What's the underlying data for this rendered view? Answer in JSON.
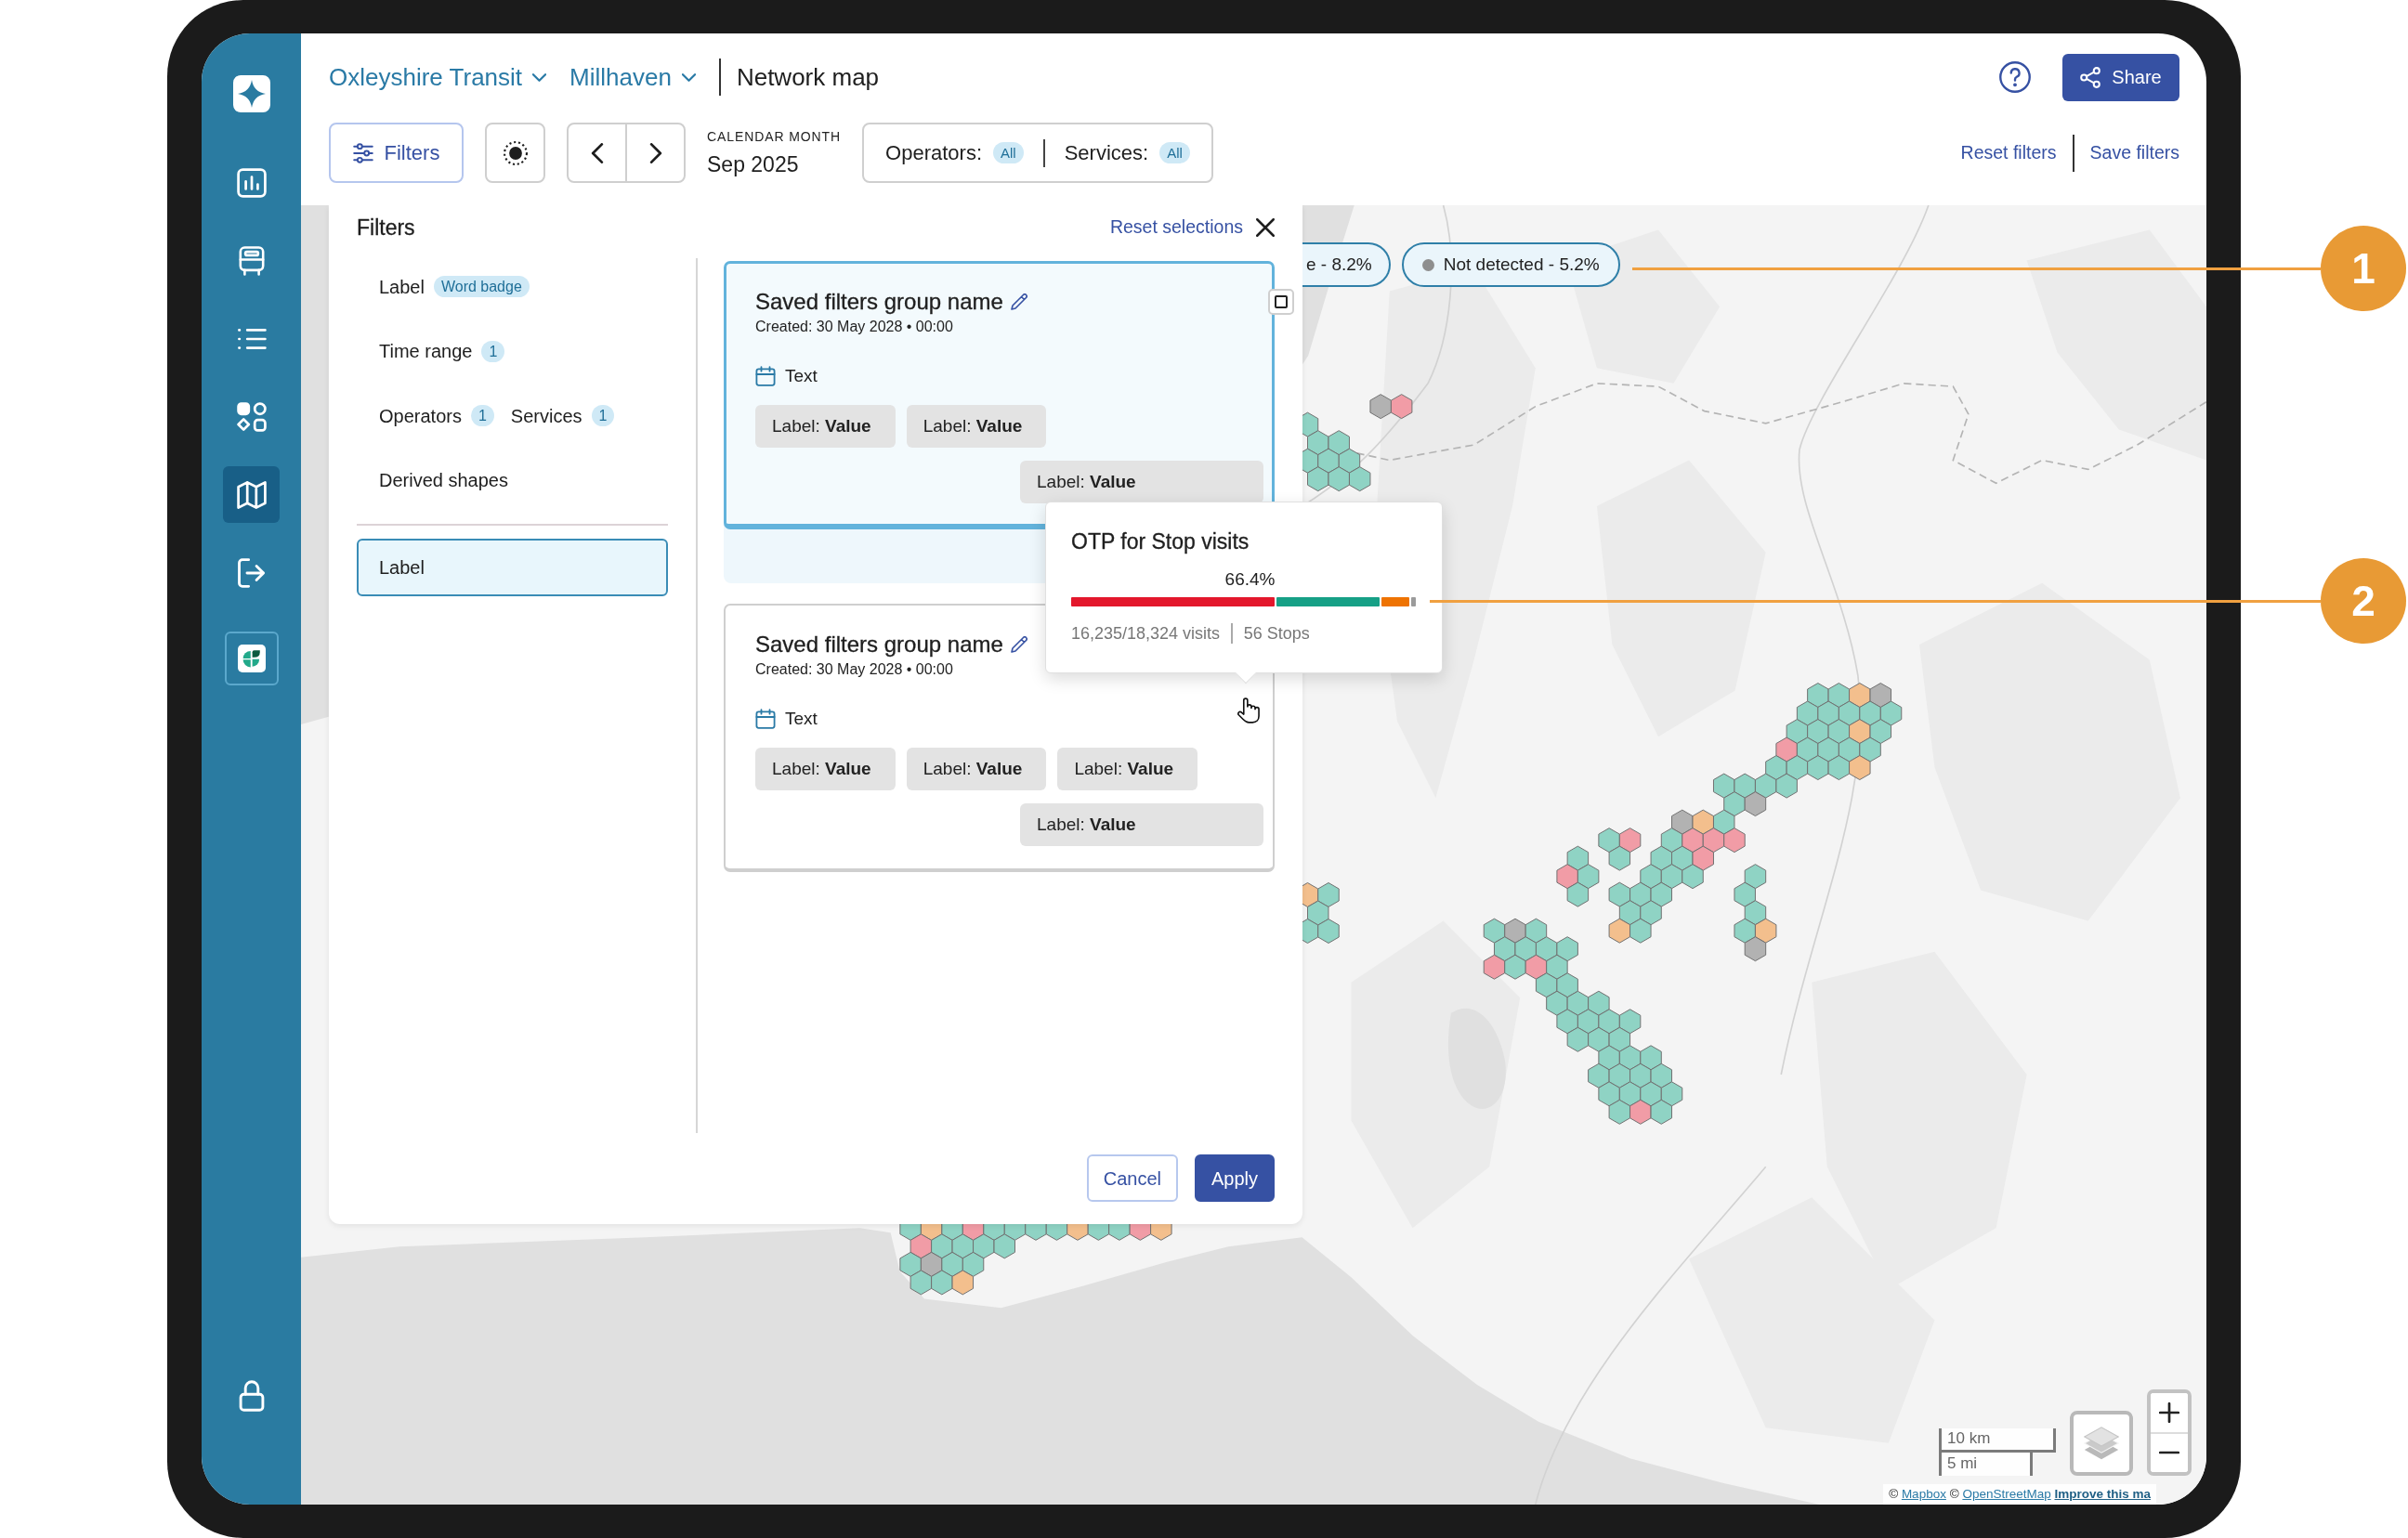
{
  "sidebar": {
    "items": [
      {
        "kind": "chart",
        "selected": false
      },
      {
        "kind": "bus",
        "selected": false
      },
      {
        "kind": "list",
        "selected": false
      },
      {
        "kind": "apps",
        "selected": false
      },
      {
        "kind": "map",
        "selected": true
      },
      {
        "kind": "exit",
        "selected": false
      },
      {
        "kind": "app",
        "selected": false
      }
    ]
  },
  "header": {
    "breadcrumbs": [
      "Oxleyshire Transit",
      "Millhaven"
    ],
    "title": "Network map",
    "share": "Share"
  },
  "toolbar": {
    "filters": {
      "label": "Filters",
      "selected": true
    },
    "period": {
      "label": "CALENDAR MONTH",
      "value": "Sep 2025"
    },
    "scope": [
      {
        "label": "Operators:",
        "badge": "All"
      },
      {
        "label": "Services:",
        "badge": "All"
      }
    ],
    "links": [
      "Reset filters",
      "Save filters"
    ]
  },
  "filter_panel": {
    "title": "Filters",
    "reset": "Reset selections",
    "categories": [
      [
        {
          "label": "Label",
          "badge": "Word badge"
        }
      ],
      [
        {
          "label": "Time range",
          "badge": "1"
        }
      ],
      [
        {
          "label": "Operators",
          "badge": "1"
        },
        {
          "label": "Services",
          "badge": "1"
        }
      ],
      [
        {
          "label": "Derived shapes"
        }
      ]
    ],
    "groups": [
      {
        "label": "Label",
        "selected": true
      }
    ],
    "cards": [
      {
        "title": "Saved filters group name",
        "created": "Created: 30 May 2028 • 00:00",
        "selected": true,
        "checked": false,
        "date": "Text",
        "chip_rows": [
          [
            "Label: **Value**",
            "Label: **Value**"
          ],
          [
            "Label: **Value**"
          ]
        ]
      },
      {
        "title": "Saved filters group name",
        "created": "Created: 30 May 2028 • 00:00",
        "selected": false,
        "date": "Text",
        "chip_rows": [
          [
            "Label: **Value**",
            "Label: **Value**",
            "Label: **Value**"
          ],
          [
            "Label: **Value**"
          ]
        ]
      }
    ],
    "actions": [
      {
        "label": "Cancel",
        "kind": "secondary"
      },
      {
        "label": "Apply",
        "kind": "primary"
      }
    ]
  },
  "map": {
    "legend": [
      {
        "label": "e - 8.2%"
      },
      {
        "label": "Not detected - 5.2%",
        "color": "#8e8e8e"
      }
    ],
    "tooltip": {
      "title": "OTP for Stop visits",
      "percent": "66.4%",
      "visits": "16,235/18,324 visits",
      "stops": "56 Stops"
    },
    "scale": [
      "10 km",
      "5 mi"
    ],
    "attribution": [
      {
        "kind": "credit",
        "prefix": "©",
        "link": "Mapbox"
      },
      {
        "kind": "credit",
        "prefix": "©",
        "link": "OpenStreetMap"
      },
      {
        "kind": "feedback",
        "link": "Improve this ma"
      }
    ]
  },
  "callouts": [
    "1",
    "2"
  ]
}
